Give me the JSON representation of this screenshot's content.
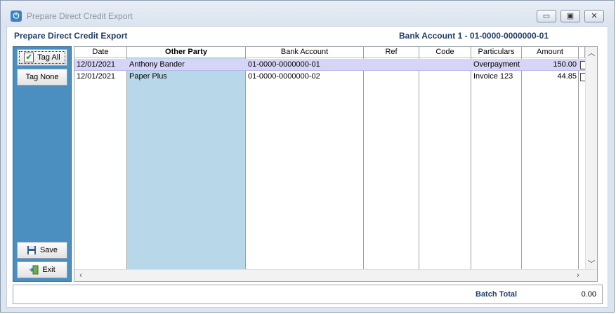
{
  "window": {
    "title": "Prepare Direct Credit Export",
    "app_icon_glyph": "⏻",
    "controls": {
      "minimize": "▭",
      "maximize": "▣",
      "close": "✕"
    }
  },
  "header": {
    "title": "Prepare Direct Credit Export",
    "bank_account": "Bank Account 1 - 01-0000-0000000-01"
  },
  "left_panel": {
    "tag_all": "Tag All",
    "tag_none": "Tag None",
    "save": "Save",
    "exit": "Exit"
  },
  "grid": {
    "columns": [
      "Date",
      "Other Party",
      "Bank Account",
      "Ref",
      "Code",
      "Particulars",
      "Amount"
    ],
    "rows": [
      {
        "date": "12/01/2021",
        "other_party": "Anthony Bander",
        "bank_account": "01-0000-0000000-01",
        "ref": "",
        "code": "",
        "particulars": "Overpayment",
        "amount": "150.00",
        "tagged": false
      },
      {
        "date": "12/01/2021",
        "other_party": "Paper Plus",
        "bank_account": "01-0000-0000000-02",
        "ref": "",
        "code": "",
        "particulars": "Invoice 123",
        "amount": "44.85",
        "tagged": false
      }
    ]
  },
  "footer": {
    "batch_total_label": "Batch Total",
    "batch_total_value": "0.00"
  },
  "colors": {
    "panel_blue": "#4a8fc0",
    "other_party_column": "#b8d8ea",
    "selected_row": "#d7d5f7",
    "heading_text": "#1f3d6b"
  }
}
